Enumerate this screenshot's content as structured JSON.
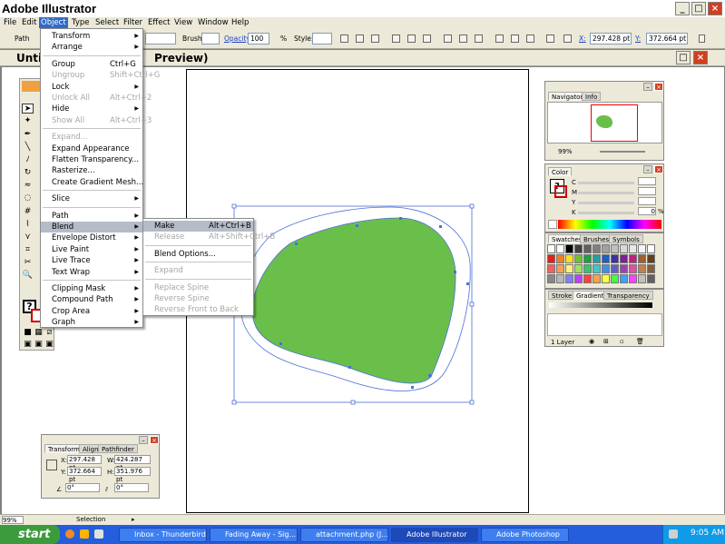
{
  "app": {
    "title": "Adobe Illustrator"
  },
  "menubar": [
    "File",
    "Edit",
    "Object",
    "Type",
    "Select",
    "Filter",
    "Effect",
    "View",
    "Window",
    "Help"
  ],
  "controlbar": {
    "selection_label": "Path",
    "brush_label": "Brush:",
    "opacity_label": "Opacity:",
    "opacity_value": "100",
    "opacity_unit": "%",
    "style_label": "Style:",
    "x_label": "X:",
    "x_value": "297.428 pt",
    "y_label": "Y:",
    "y_value": "372.664 pt"
  },
  "document": {
    "title_left": "Unti",
    "title_right": "Preview)"
  },
  "object_menu": [
    {
      "label": "Transform",
      "submenu": true
    },
    {
      "label": "Arrange",
      "submenu": true
    },
    {
      "sep": true
    },
    {
      "label": "Group",
      "shortcut": "Ctrl+G"
    },
    {
      "label": "Ungroup",
      "shortcut": "Shift+Ctrl+G",
      "disabled": true
    },
    {
      "label": "Lock",
      "submenu": true
    },
    {
      "label": "Unlock All",
      "shortcut": "Alt+Ctrl+2",
      "disabled": true
    },
    {
      "label": "Hide",
      "submenu": true
    },
    {
      "label": "Show All",
      "shortcut": "Alt+Ctrl+3",
      "disabled": true
    },
    {
      "sep": true
    },
    {
      "label": "Expand...",
      "disabled": true
    },
    {
      "label": "Expand Appearance"
    },
    {
      "label": "Flatten Transparency..."
    },
    {
      "label": "Rasterize..."
    },
    {
      "label": "Create Gradient Mesh..."
    },
    {
      "sep": true
    },
    {
      "label": "Slice",
      "submenu": true
    },
    {
      "sep": true
    },
    {
      "label": "Path",
      "submenu": true
    },
    {
      "label": "Blend",
      "submenu": true,
      "highlight": true
    },
    {
      "label": "Envelope Distort",
      "submenu": true
    },
    {
      "label": "Live Paint",
      "submenu": true
    },
    {
      "label": "Live Trace",
      "submenu": true
    },
    {
      "label": "Text Wrap",
      "submenu": true
    },
    {
      "sep": true
    },
    {
      "label": "Clipping Mask",
      "submenu": true
    },
    {
      "label": "Compound Path",
      "submenu": true
    },
    {
      "label": "Crop Area",
      "submenu": true
    },
    {
      "label": "Graph",
      "submenu": true
    }
  ],
  "blend_menu": [
    {
      "label": "Make",
      "shortcut": "Alt+Ctrl+B",
      "highlight": true
    },
    {
      "label": "Release",
      "shortcut": "Alt+Shift+Ctrl+B",
      "disabled": true
    },
    {
      "sep": true
    },
    {
      "label": "Blend Options..."
    },
    {
      "sep": true
    },
    {
      "label": "Expand",
      "disabled": true
    },
    {
      "sep": true
    },
    {
      "label": "Replace Spine",
      "disabled": true
    },
    {
      "label": "Reverse Spine",
      "disabled": true
    },
    {
      "label": "Reverse Front to Back",
      "disabled": true
    }
  ],
  "navigator_panel": {
    "tabs": [
      "Navigator",
      "Info"
    ],
    "zoom": "99%"
  },
  "color_panel": {
    "tab": "Color",
    "channels": [
      "C",
      "M",
      "Y",
      "K"
    ],
    "k_value": "0",
    "unit": "%"
  },
  "swatches_panel": {
    "tabs": [
      "Swatches",
      "Brushes",
      "Symbols"
    ]
  },
  "stroke_panel": {
    "tabs": [
      "Stroke",
      "Gradient",
      "Transparency"
    ],
    "layers_count": "1 Layer"
  },
  "transform_panel": {
    "tabs": [
      "Transform",
      "Align",
      "Pathfinder"
    ],
    "x_label": "X:",
    "x_value": "297.428 pt",
    "y_label": "Y:",
    "y_value": "372.664 pt",
    "w_label": "W:",
    "w_value": "424.287 pt",
    "h_label": "H:",
    "h_value": "351.976 pt",
    "rotate_value": "0°",
    "shear_value": "0°"
  },
  "statusbar": {
    "zoom": "99%",
    "info": "Selection"
  },
  "taskbar": {
    "start_label": "start",
    "tasks": [
      "Inbox - Thunderbird",
      "Fading Away - Sig...",
      "attachment.php (J...",
      "Adobe Illustrator",
      "Adobe Photoshop"
    ],
    "time": "9:05 AM"
  },
  "colors": {
    "shape_fill": "#6abf4b",
    "selection_blue": "#4a6fd8",
    "menu_highlight": "#b5bcc8"
  }
}
